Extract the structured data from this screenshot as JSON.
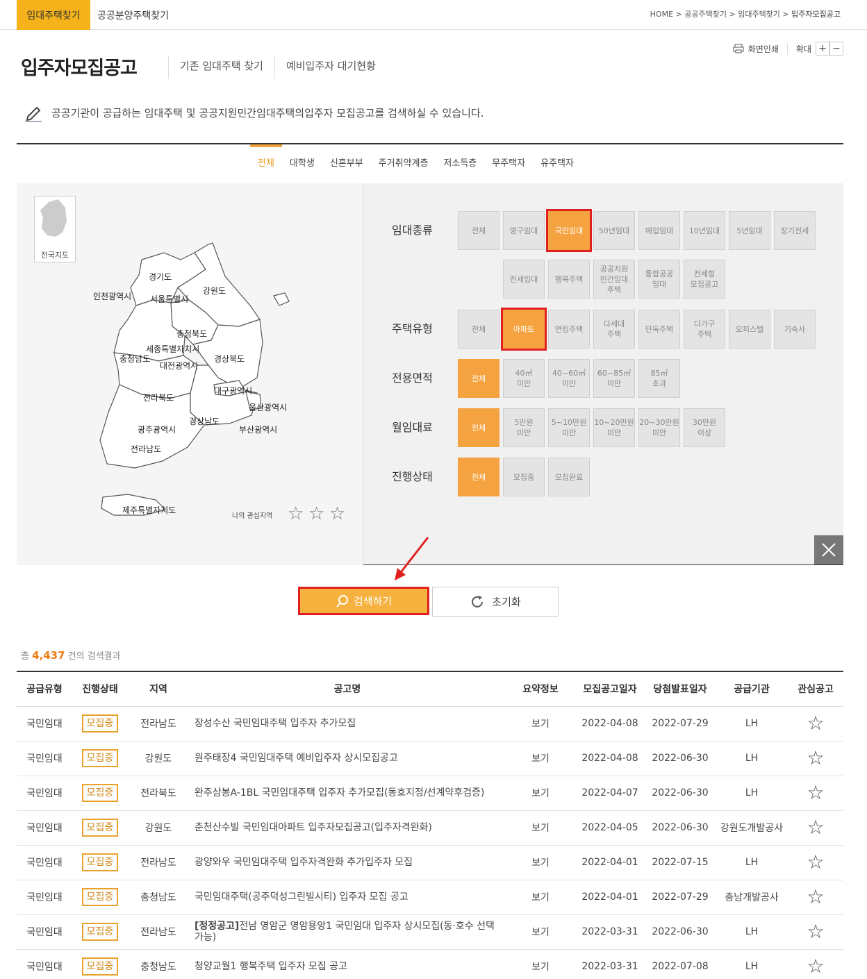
{
  "nav": {
    "tab_active": "임대주택찾기",
    "tab_other": "공공분양주택찾기",
    "breadcrumb": [
      "HOME",
      "공공주택찾기",
      "임대주택찾기",
      "입주자모집공고"
    ]
  },
  "header": {
    "title": "입주자모집공고",
    "subtabs": [
      "기존 임대주택 찾기",
      "예비입주자 대기현황"
    ],
    "print_label": "화면인쇄",
    "zoom_label": "확대",
    "zoom_in": "+",
    "zoom_out": "−"
  },
  "description": {
    "prefix": "공공기관이 공급하는 임대주택 및 공공지원민간임대주택의 ",
    "highlight": "입주자 모집공고",
    "suffix": "를 검색하실 수 있습니다."
  },
  "categories": [
    "전체",
    "대학생",
    "신혼부부",
    "주거취약계층",
    "저소득층",
    "무주택자",
    "유주택자"
  ],
  "active_category": "전체",
  "map": {
    "mini_label": "전국지도",
    "regions": [
      "경기도",
      "인천광역시",
      "서울특별시",
      "강원도",
      "충청북도",
      "세종특별자치시",
      "충청남도",
      "대전광역시",
      "경상북도",
      "대구광역시",
      "울산광역시",
      "전라북도",
      "경상남도",
      "광주광역시",
      "부산광역시",
      "전라남도",
      "제주특별자치도"
    ],
    "fav_label": "나의 관심지역",
    "fav_star": "☆"
  },
  "filters": {
    "rent_type": {
      "label": "임대종류",
      "options": [
        "전체",
        "영구임대",
        "국민임대",
        "50년임대",
        "매입임대",
        "10년임대",
        "5년임대",
        "장기전세",
        "전세임대",
        "행복주택",
        "공공지원\n민간임대\n주택",
        "통합공공\n임대",
        "전세형\n모집공고"
      ],
      "selected": "국민임대"
    },
    "house_type": {
      "label": "주택유형",
      "options": [
        "전체",
        "아파트",
        "연립주택",
        "다세대\n주택",
        "단독주택",
        "다가구\n주택",
        "오피스텔",
        "기숙사"
      ],
      "selected": "아파트"
    },
    "area": {
      "label": "전용면적",
      "options": [
        "전체",
        "40㎡\n미만",
        "40~60㎡\n미만",
        "60~85㎡\n미만",
        "85㎡\n초과"
      ],
      "selected": "전체"
    },
    "rent": {
      "label": "월임대료",
      "options": [
        "전체",
        "5만원\n미만",
        "5~10만원\n미만",
        "10~20만원\n미만",
        "20~30만원\n미만",
        "30만원\n이상"
      ],
      "selected": "전체"
    },
    "status": {
      "label": "진행상태",
      "options": [
        "전체",
        "모집중",
        "모집완료"
      ],
      "selected": "전체"
    }
  },
  "buttons": {
    "search": "검색하기",
    "reset": "초기화"
  },
  "results": {
    "prefix": "총 ",
    "count": "4,437",
    "suffix": " 건의 검색결과"
  },
  "table": {
    "headers": [
      "공급유형",
      "진행상태",
      "지역",
      "공고명",
      "요약정보",
      "모집공고일자",
      "당첨발표일자",
      "공급기관",
      "관심공고"
    ],
    "rows": [
      {
        "type": "국민임대",
        "status": "모집중",
        "region": "전라남도",
        "title_prefix": "",
        "title": "장성수산 국민임대주택 입주자 추가모집",
        "info": "보기",
        "posted": "2022-04-08",
        "announce": "2022-07-29",
        "agency": "LH"
      },
      {
        "type": "국민임대",
        "status": "모집중",
        "region": "강원도",
        "title_prefix": "",
        "title": "원주태장4 국민임대주택 예비입주자 상시모집공고",
        "info": "보기",
        "posted": "2022-04-08",
        "announce": "2022-06-30",
        "agency": "LH"
      },
      {
        "type": "국민임대",
        "status": "모집중",
        "region": "전라북도",
        "title_prefix": "",
        "title": "완주삼봉A-1BL 국민임대주택 입주자 추가모집(동호지정/선계약후검증)",
        "info": "보기",
        "posted": "2022-04-07",
        "announce": "2022-06-30",
        "agency": "LH"
      },
      {
        "type": "국민임대",
        "status": "모집중",
        "region": "강원도",
        "title_prefix": "",
        "title": "춘천산수빌 국민임대아파트 입주자모집공고(입주자격완화)",
        "info": "보기",
        "posted": "2022-04-05",
        "announce": "2022-06-30",
        "agency": "강원도개발공사"
      },
      {
        "type": "국민임대",
        "status": "모집중",
        "region": "전라남도",
        "title_prefix": "",
        "title": "광양와우 국민임대주택 입주자격완화 추가입주자 모집",
        "info": "보기",
        "posted": "2022-04-01",
        "announce": "2022-07-15",
        "agency": "LH"
      },
      {
        "type": "국민임대",
        "status": "모집중",
        "region": "충청남도",
        "title_prefix": "",
        "title": "국민임대주택(공주덕성그린빌시티) 입주자 모집 공고",
        "info": "보기",
        "posted": "2022-04-01",
        "announce": "2022-07-29",
        "agency": "충남개발공사"
      },
      {
        "type": "국민임대",
        "status": "모집중",
        "region": "전라남도",
        "title_prefix": "[정정공고]",
        "title": "전남 영암군 영암용앙1 국민임대 입주자 상시모집(동·호수 선택 가능)",
        "info": "보기",
        "posted": "2022-03-31",
        "announce": "2022-06-30",
        "agency": "LH"
      },
      {
        "type": "국민임대",
        "status": "모집중",
        "region": "충청남도",
        "title_prefix": "",
        "title": "청양교월1 행복주택 입주자 모집 공고",
        "info": "보기",
        "posted": "2022-03-31",
        "announce": "2022-07-08",
        "agency": "LH"
      }
    ],
    "star": "☆"
  },
  "colors": {
    "accent": "#f5b21b",
    "selected": "#f5a340",
    "highlight_border": "#e02020"
  }
}
